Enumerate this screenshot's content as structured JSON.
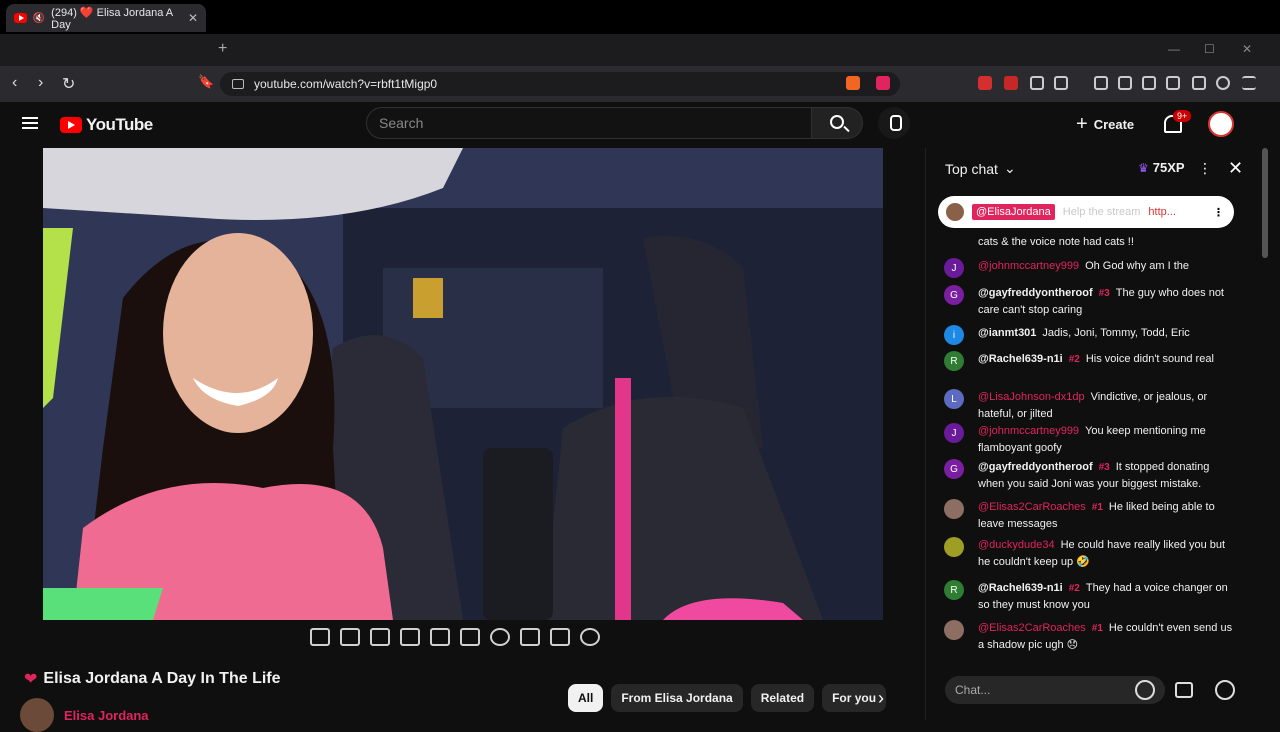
{
  "browser": {
    "tab_title": "(294) ❤️ Elisa Jordana A Day",
    "tab_count": "(294)",
    "url": "youtube.com/watch?v=rbft1tMigp0",
    "new_tab": "+"
  },
  "youtube": {
    "logo": "YouTube",
    "search_placeholder": "Search",
    "create_label": "Create",
    "notifications_badge": "9+"
  },
  "video": {
    "title": "Elisa Jordana A Day In The Life",
    "channel": "Elisa Jordana"
  },
  "chips": [
    "All",
    "From Elisa Jordana",
    "Related",
    "For you"
  ],
  "chat": {
    "header": "Top chat",
    "xp": "75XP",
    "pinned_user": "@ElisaJordana",
    "pinned_text": "Help the stream",
    "pinned_link": "http...",
    "input_placeholder": "Chat...",
    "messages": [
      {
        "user": "",
        "text": "cats & the voice note had cats !!",
        "avatar": "",
        "color": "#444"
      },
      {
        "user": "@johnmccartney999",
        "text": "Oh God why am I the",
        "avatar": "J",
        "color": "#6a1b9a",
        "red": true
      },
      {
        "user": "@gayfreddyontheroof",
        "rank": "#3",
        "text": "The guy who does not care can't stop caring",
        "avatar": "G",
        "color": "#7b1fa2"
      },
      {
        "user": "@ianmt301",
        "text": "Jadis, Joni, Tommy, Todd, Eric",
        "avatar": "i",
        "color": "#1e88e5"
      },
      {
        "user": "@Rachel639-n1i",
        "rank": "#2",
        "text": "His voice didn't sound real",
        "avatar": "R",
        "color": "#2e7d32"
      },
      {
        "user": "@LisaJohnson-dx1dp",
        "text": "Vindictive, or jealous, or hateful, or jilted",
        "avatar": "L",
        "color": "#5c6bc0",
        "red": true
      },
      {
        "user": "@johnmccartney999",
        "text": "You keep mentioning me flamboyant goofy",
        "avatar": "J",
        "color": "#6a1b9a",
        "red": true
      },
      {
        "user": "@gayfreddyontheroof",
        "rank": "#3",
        "text": "It stopped donating when you said Joni was your biggest mistake.",
        "avatar": "G",
        "color": "#7b1fa2"
      },
      {
        "user": "@Elisas2CarRoaches",
        "rank": "#1",
        "text": "He liked being able to leave messages",
        "avatar": "",
        "color": "#8d6e63",
        "red": true
      },
      {
        "user": "@duckydude34",
        "text": "He could have really liked you but he couldn't keep up 🤣",
        "avatar": "",
        "color": "#9e9d24",
        "red": true
      },
      {
        "user": "@Rachel639-n1i",
        "rank": "#2",
        "text": "They had a voice changer on so they must know you",
        "avatar": "R",
        "color": "#2e7d32"
      },
      {
        "user": "@Elisas2CarRoaches",
        "rank": "#1",
        "text": "He couldn't even send us a shadow pic ugh 😞",
        "avatar": "",
        "color": "#8d6e63",
        "red": true
      }
    ]
  }
}
